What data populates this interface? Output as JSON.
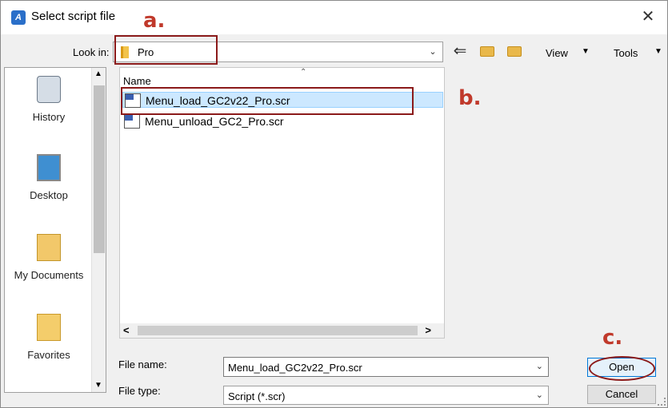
{
  "window": {
    "title": "Select script file",
    "close_label": "✕"
  },
  "toolbar": {
    "lookin_label": "Look in:",
    "lookin_value": "Pro",
    "view_label": "View",
    "tools_label": "Tools"
  },
  "places": [
    {
      "label": "History",
      "icon": "history-icon"
    },
    {
      "label": "Desktop",
      "icon": "desktop-icon"
    },
    {
      "label": "My Documents",
      "icon": "documents-icon"
    },
    {
      "label": "Favorites",
      "icon": "favorites-icon"
    }
  ],
  "filelist": {
    "column_header": "Name",
    "files": [
      {
        "name": "Menu_load_GC2v22_Pro.scr",
        "selected": true
      },
      {
        "name": "Menu_unload_GC2_Pro.scr",
        "selected": false
      }
    ]
  },
  "fields": {
    "filename_label": "File name:",
    "filename_value": "Menu_load_GC2v22_Pro.scr",
    "filetype_label": "File type:",
    "filetype_value": "Script (*.scr)"
  },
  "buttons": {
    "open": "Open",
    "cancel": "Cancel"
  },
  "annotations": {
    "a": "a.",
    "b": "b.",
    "c": "c.",
    "color": "#c0392b"
  }
}
